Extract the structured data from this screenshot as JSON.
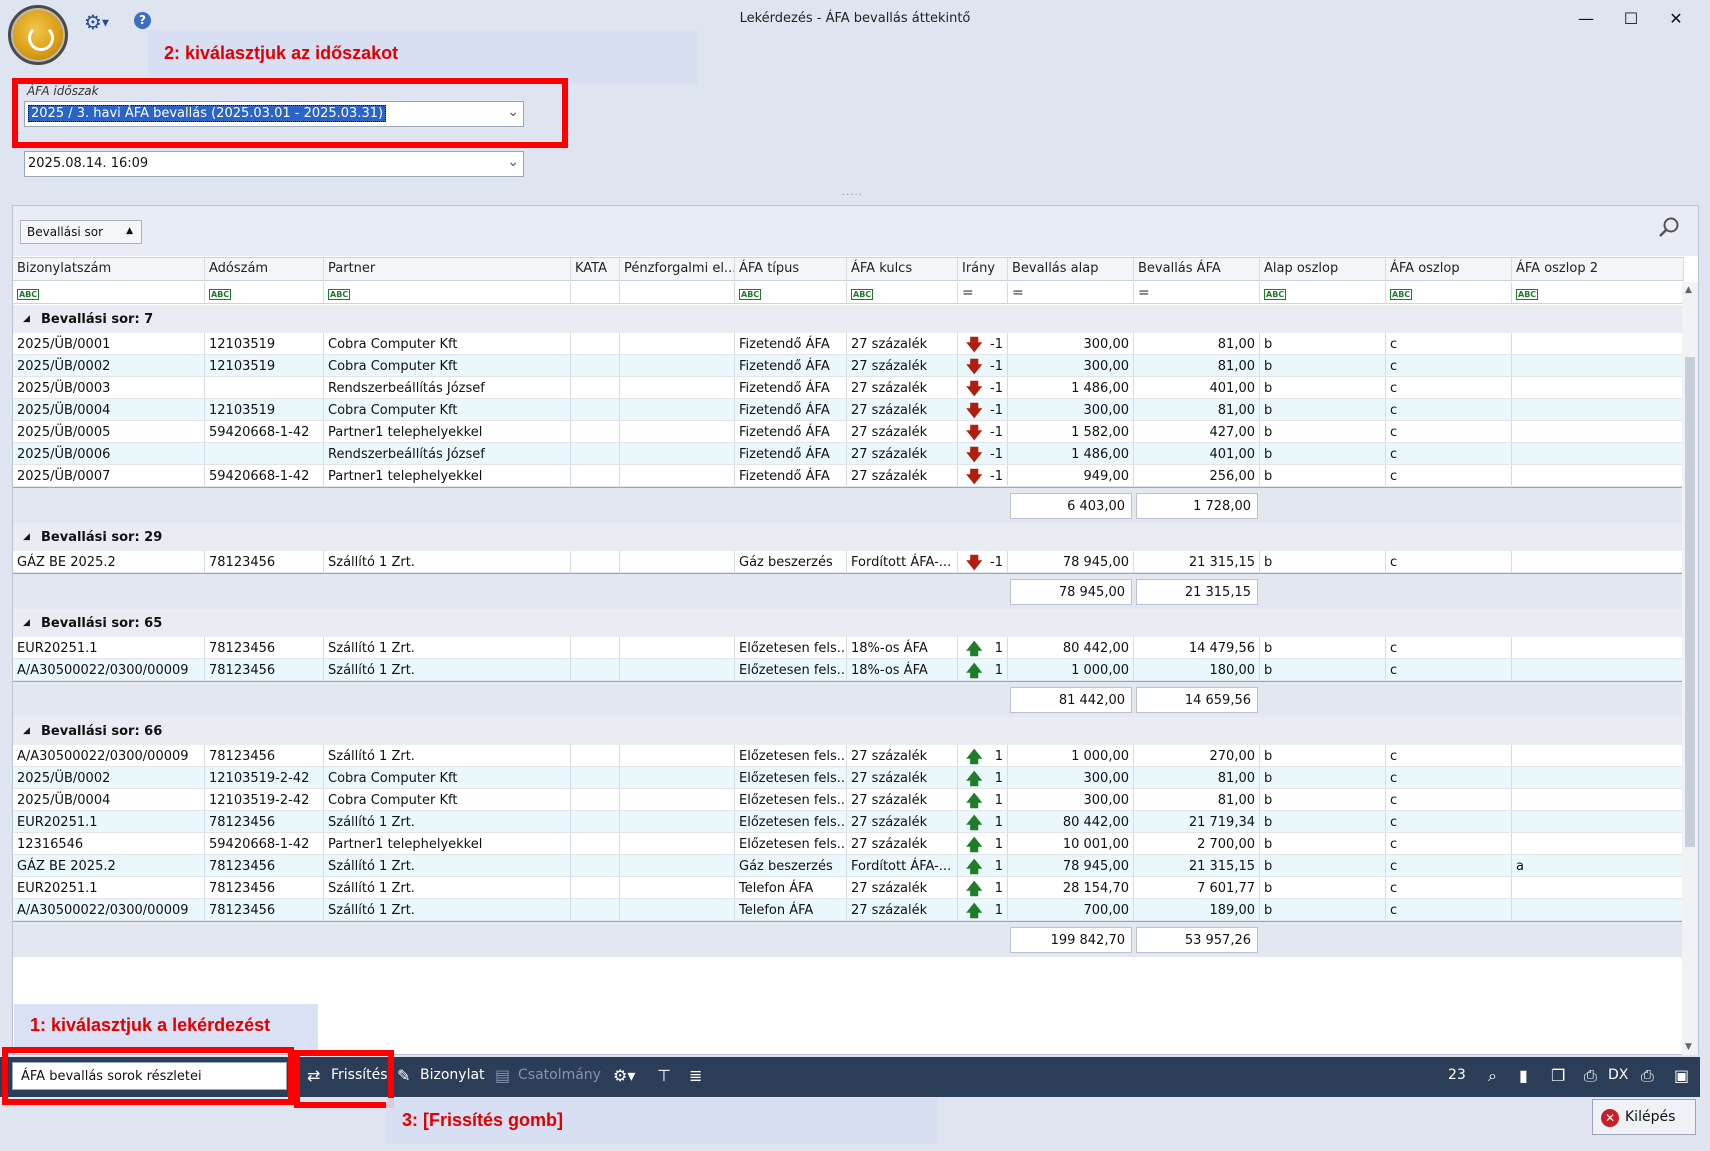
{
  "window": {
    "title": "Lekérdezés - ÁFA bevallás áttekintő"
  },
  "annotations": {
    "step2": "2: kiválasztjuk az időszakot",
    "step1": "1: kiválasztjuk a lekérdezést",
    "step3": "3: [Frissítés gomb]"
  },
  "form": {
    "period_label": "ÁFA időszak",
    "period_value": "2025 / 3. havi ÁFA bevallás (2025.03.01 - 2025.03.31)",
    "date_value": "2025.08.14. 16:09"
  },
  "grid": {
    "group_chip": "Bevallási sor",
    "columns": [
      "Bizonylatszám",
      "Adószám",
      "Partner",
      "KATA",
      "Pénzforgalmi el...",
      "ÁFA típus",
      "ÁFA kulcs",
      "Irány",
      "Bevallás alap",
      "Bevallás ÁFA",
      "Alap oszlop",
      "ÁFA oszlop",
      "ÁFA oszlop 2"
    ],
    "filter_types": [
      "abc",
      "abc",
      "abc",
      "",
      "",
      "abc",
      "abc",
      "eq",
      "eq",
      "eq",
      "abc",
      "abc",
      "abc"
    ],
    "groups": [
      {
        "title": "Bevallási sor: 7",
        "rows": [
          [
            "2025/ÜB/0001",
            "12103519",
            "Cobra Computer Kft",
            "",
            "",
            "Fizetendő ÁFA",
            "27 százalék",
            "down",
            "-1",
            "300,00",
            "81,00",
            "b",
            "c",
            ""
          ],
          [
            "2025/ÜB/0002",
            "12103519",
            "Cobra Computer Kft",
            "",
            "",
            "Fizetendő ÁFA",
            "27 százalék",
            "down",
            "-1",
            "300,00",
            "81,00",
            "b",
            "c",
            ""
          ],
          [
            "2025/ÜB/0003",
            "",
            "Rendszerbeállítás József",
            "",
            "",
            "Fizetendő ÁFA",
            "27 százalék",
            "down",
            "-1",
            "1 486,00",
            "401,00",
            "b",
            "c",
            ""
          ],
          [
            "2025/ÜB/0004",
            "12103519",
            "Cobra Computer Kft",
            "",
            "",
            "Fizetendő ÁFA",
            "27 százalék",
            "down",
            "-1",
            "300,00",
            "81,00",
            "b",
            "c",
            ""
          ],
          [
            "2025/ÜB/0005",
            "59420668-1-42",
            "Partner1 telephelyekkel",
            "",
            "",
            "Fizetendő ÁFA",
            "27 százalék",
            "down",
            "-1",
            "1 582,00",
            "427,00",
            "b",
            "c",
            ""
          ],
          [
            "2025/ÜB/0006",
            "",
            "Rendszerbeállítás József",
            "",
            "",
            "Fizetendő ÁFA",
            "27 százalék",
            "down",
            "-1",
            "1 486,00",
            "401,00",
            "b",
            "c",
            ""
          ],
          [
            "2025/ÜB/0007",
            "59420668-1-42",
            "Partner1 telephelyekkel",
            "",
            "",
            "Fizetendő ÁFA",
            "27 százalék",
            "down",
            "-1",
            "949,00",
            "256,00",
            "b",
            "c",
            ""
          ]
        ],
        "sum_base": "6 403,00",
        "sum_vat": "1 728,00"
      },
      {
        "title": "Bevallási sor: 29",
        "rows": [
          [
            "GÁZ BE 2025.2",
            "78123456",
            "Szállító 1 Zrt.",
            "",
            "",
            "Gáz beszerzés",
            "Fordított ÁFA-...",
            "down",
            "-1",
            "78 945,00",
            "21 315,15",
            "b",
            "c",
            ""
          ]
        ],
        "sum_base": "78 945,00",
        "sum_vat": "21 315,15"
      },
      {
        "title": "Bevallási sor: 65",
        "rows": [
          [
            "EUR20251.1",
            "78123456",
            "Szállító 1 Zrt.",
            "",
            "",
            "Előzetesen fels...",
            "18%-os ÁFA",
            "up",
            "1",
            "80 442,00",
            "14 479,56",
            "b",
            "c",
            ""
          ],
          [
            "A/A30500022/0300/00009",
            "78123456",
            "Szállító 1 Zrt.",
            "",
            "",
            "Előzetesen fels...",
            "18%-os ÁFA",
            "up",
            "1",
            "1 000,00",
            "180,00",
            "b",
            "c",
            ""
          ]
        ],
        "sum_base": "81 442,00",
        "sum_vat": "14 659,56"
      },
      {
        "title": "Bevallási sor: 66",
        "rows": [
          [
            "A/A30500022/0300/00009",
            "78123456",
            "Szállító 1 Zrt.",
            "",
            "",
            "Előzetesen fels...",
            "27 százalék",
            "up",
            "1",
            "1 000,00",
            "270,00",
            "b",
            "c",
            ""
          ],
          [
            "2025/ÜB/0002",
            "12103519-2-42",
            "Cobra Computer Kft",
            "",
            "",
            "Előzetesen fels...",
            "27 százalék",
            "up",
            "1",
            "300,00",
            "81,00",
            "b",
            "c",
            ""
          ],
          [
            "2025/ÜB/0004",
            "12103519-2-42",
            "Cobra Computer Kft",
            "",
            "",
            "Előzetesen fels...",
            "27 százalék",
            "up",
            "1",
            "300,00",
            "81,00",
            "b",
            "c",
            ""
          ],
          [
            "EUR20251.1",
            "78123456",
            "Szállító 1 Zrt.",
            "",
            "",
            "Előzetesen fels...",
            "27 százalék",
            "up",
            "1",
            "80 442,00",
            "21 719,34",
            "b",
            "c",
            ""
          ],
          [
            "12316546",
            "59420668-1-42",
            "Partner1 telephelyekkel",
            "",
            "",
            "Előzetesen fels...",
            "27 százalék",
            "up",
            "1",
            "10 001,00",
            "2 700,00",
            "b",
            "c",
            ""
          ],
          [
            "GÁZ BE 2025.2",
            "78123456",
            "Szállító 1 Zrt.",
            "",
            "",
            "Gáz beszerzés",
            "Fordított ÁFA-...",
            "up",
            "1",
            "78 945,00",
            "21 315,15",
            "b",
            "c",
            "a"
          ],
          [
            "EUR20251.1",
            "78123456",
            "Szállító 1 Zrt.",
            "",
            "",
            "Telefon ÁFA",
            "27 százalék",
            "up",
            "1",
            "28 154,70",
            "7 601,77",
            "b",
            "c",
            ""
          ],
          [
            "A/A30500022/0300/00009",
            "78123456",
            "Szállító 1 Zrt.",
            "",
            "",
            "Telefon ÁFA",
            "27 százalék",
            "up",
            "1",
            "700,00",
            "189,00",
            "b",
            "c",
            ""
          ]
        ],
        "sum_base": "199 842,70",
        "sum_vat": "53 957,26"
      }
    ]
  },
  "toolbar": {
    "query_value": "ÁFA bevallás sorok részletei",
    "refresh": "Frissítés",
    "document": "Bizonylat",
    "attachment": "Csatolmány",
    "count": "23",
    "dx": "DX",
    "exit": "Kilépés"
  }
}
